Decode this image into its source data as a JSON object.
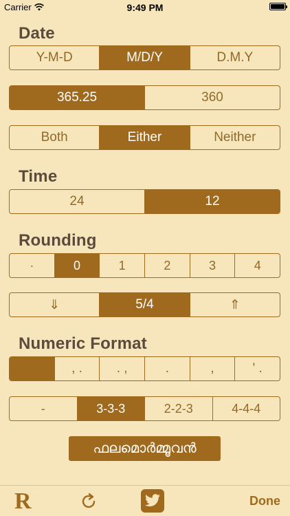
{
  "status": {
    "carrier": "Carrier",
    "time": "9:49 PM"
  },
  "date": {
    "title": "Date",
    "format": [
      "Y-M-D",
      "M/D/Y",
      "D.M.Y"
    ],
    "format_selected": 1,
    "year": [
      "365.25",
      "360"
    ],
    "year_selected": 0,
    "inclusion": [
      "Both",
      "Either",
      "Neither"
    ],
    "inclusion_selected": 1
  },
  "time": {
    "title": "Time",
    "options": [
      "24",
      "12"
    ],
    "selected": 1
  },
  "rounding": {
    "title": "Rounding",
    "digits": [
      "·",
      "0",
      "1",
      "2",
      "3",
      "4"
    ],
    "digits_selected": 1,
    "mode": [
      "⇓",
      "5/4",
      "⇑"
    ],
    "mode_selected": 1
  },
  "numeric_format": {
    "title": "Numeric Format",
    "separators": [
      "",
      ", .",
      ". ,",
      ".",
      ",",
      "' ."
    ],
    "separators_selected": 0,
    "grouping": [
      "-",
      "3-3-3",
      "2-2-3",
      "4-4-4"
    ],
    "grouping_selected": 1
  },
  "language_button": "ഫലമൊർമ്മൂവൻ",
  "toolbar": {
    "logo": "R",
    "done": "Done"
  }
}
